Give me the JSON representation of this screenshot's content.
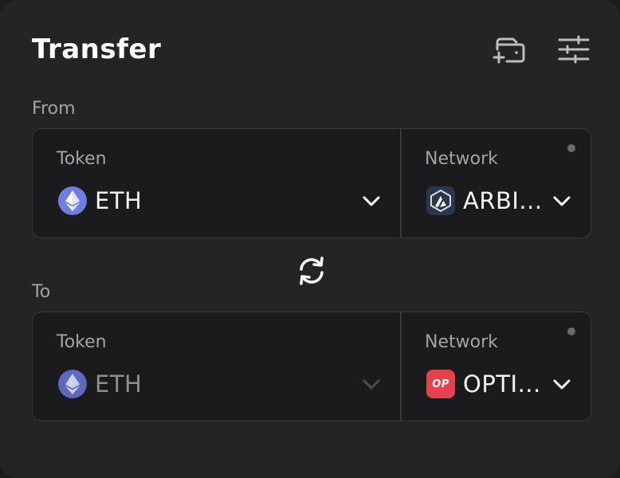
{
  "header": {
    "title": "Transfer",
    "wallet_icon": "add-wallet-icon",
    "settings_icon": "sliders-icon"
  },
  "from": {
    "section_label": "From",
    "token_label": "Token",
    "token_value": "ETH",
    "token_icon": "eth-logo-icon",
    "network_label": "Network",
    "network_value": "ARBI...",
    "network_icon": "arbitrum-logo-icon"
  },
  "swap": {
    "icon": "swap-arrows-icon"
  },
  "to": {
    "section_label": "To",
    "token_label": "Token",
    "token_value": "ETH",
    "token_icon": "eth-logo-icon",
    "network_label": "Network",
    "network_value": "OPTI...",
    "network_icon": "optimism-logo-icon",
    "network_logo_text": "OP"
  },
  "colors": {
    "background": "#242426",
    "box": "#1b1b1d",
    "border": "#38383b",
    "muted_text": "#a3a3a6",
    "eth": "#6f7ee0",
    "arbitrum": "#2c374b",
    "optimism": "#e5414d"
  }
}
